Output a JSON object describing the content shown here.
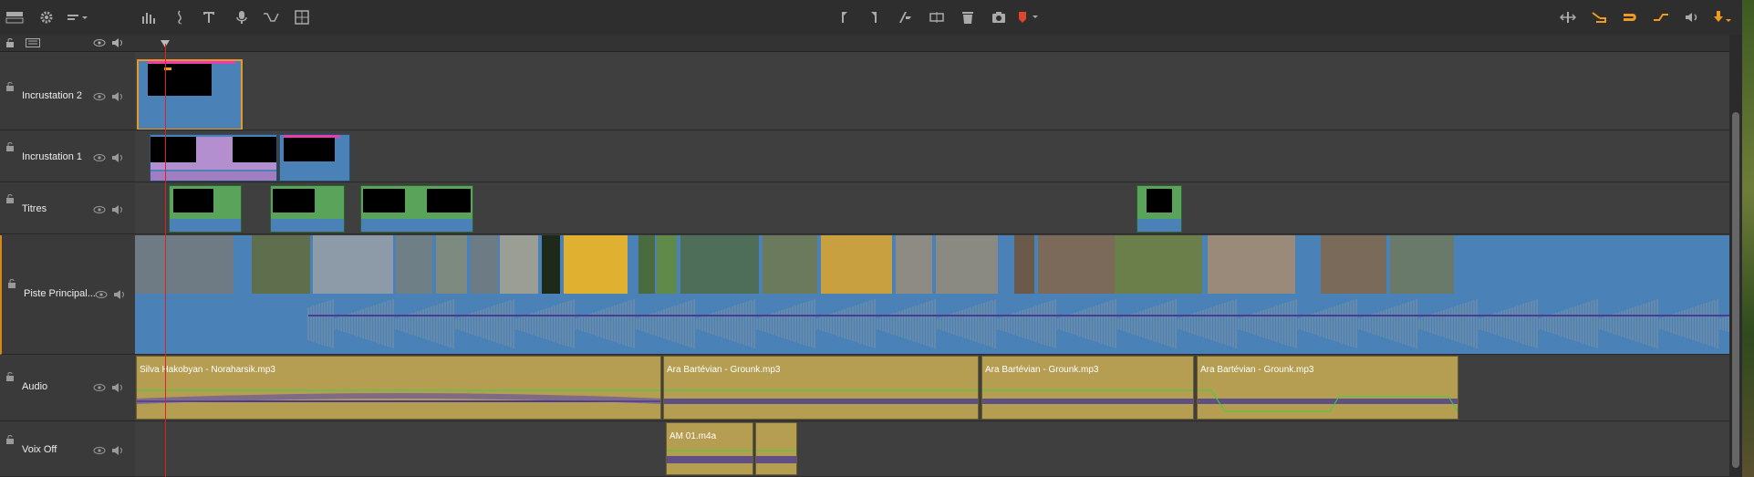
{
  "toolbar": {
    "left_icons": [
      "storyboard-icon",
      "settings-gear-icon",
      "track-layout-icon",
      "audio-mixer-icon",
      "scorekeeper-icon",
      "title-icon",
      "voiceover-mic-icon",
      "audio-ducking-icon",
      "multicam-icon"
    ],
    "center_icons": [
      "mark-in-icon",
      "mark-out-icon",
      "razor-icon",
      "split-icon",
      "delete-icon",
      "snapshot-icon",
      "marker-icon"
    ],
    "right_icons": [
      "ripple-icon",
      "insert-mode-icon",
      "magnet-icon",
      "dynamic-length-icon",
      "audio-scrub-icon",
      "download-icon"
    ]
  },
  "tracks": [
    {
      "name": "Incrustation 2"
    },
    {
      "name": "Incrustation 1"
    },
    {
      "name": "Titres"
    },
    {
      "name": "Piste Principal..."
    },
    {
      "name": "Audio"
    },
    {
      "name": "Voix Off"
    }
  ],
  "audio_clips": [
    {
      "name": "Silva Hakobyan - Noraharsik.mp3"
    },
    {
      "name": "Ara Bartévian - Grounk.mp3"
    },
    {
      "name": "Ara Bartévian - Grounk.mp3"
    },
    {
      "name": "Ara Bartévian - Grounk.mp3"
    }
  ],
  "voiceover_clips": [
    {
      "name": "AM 01.m4a"
    },
    {
      "name": ""
    }
  ],
  "colors": {
    "video_clip": "#4a82b8",
    "audio_clip": "#b59d52",
    "title_clip": "#5aa35a",
    "overlay_clip": "#b48fd0",
    "volume_line": "#3ad33a",
    "playhead": "#dd2222",
    "selection": "#d6881a"
  }
}
